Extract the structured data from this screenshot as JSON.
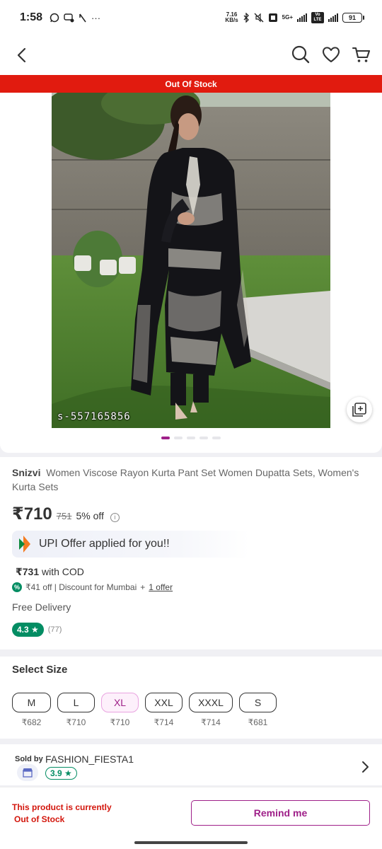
{
  "status_bar": {
    "time": "1:58",
    "left_icons": [
      "whatsapp-icon",
      "chat-icon",
      "slash-icon",
      "more-icon"
    ],
    "net_speed_value": "7.16",
    "net_speed_unit": "KB/s",
    "network": "5G+",
    "vo": "Vo LTE",
    "battery": "91"
  },
  "topbar": {
    "icons": [
      "back-arrow-icon",
      "search-icon",
      "heart-icon",
      "cart-icon"
    ]
  },
  "banner": {
    "text": "Out Of Stock"
  },
  "gallery": {
    "image_id": "s-557165856",
    "image_count": 5,
    "active_index": 0
  },
  "product": {
    "brand": "Snizvi",
    "name": "Women Viscose Rayon Kurta Pant Set Women Dupatta Sets, Women's Kurta  Sets",
    "price": "₹710",
    "mrp": "751",
    "discount": "5% off",
    "upi_offer": "UPI Offer applied for you!!",
    "cod_price": "₹731",
    "cod_label": "with COD",
    "discount_line": "₹41 off | Discount for Mumbai",
    "plus": "+",
    "offer_link": "1 offer",
    "delivery": "Free Delivery",
    "rating": "4.3",
    "rating_count": "(77)"
  },
  "sizes": {
    "title": "Select Size",
    "selected": "XL",
    "items": [
      {
        "label": "M",
        "price": "₹682"
      },
      {
        "label": "L",
        "price": "₹710"
      },
      {
        "label": "XL",
        "price": "₹710"
      },
      {
        "label": "XXL",
        "price": "₹714"
      },
      {
        "label": "XXXL",
        "price": "₹714"
      },
      {
        "label": "S",
        "price": "₹681"
      }
    ]
  },
  "seller": {
    "sold_by": "Sold by",
    "name": "FASHION_FIESTA1",
    "rating": "3.9"
  },
  "bottom_bar": {
    "oos_line1": "This product is currently",
    "oos_line2": "Out of Stock",
    "remind_label": "Remind me"
  },
  "colors": {
    "accent": "#9f2089",
    "banner_red": "#e11b0f",
    "rating_green": "#038d63"
  }
}
